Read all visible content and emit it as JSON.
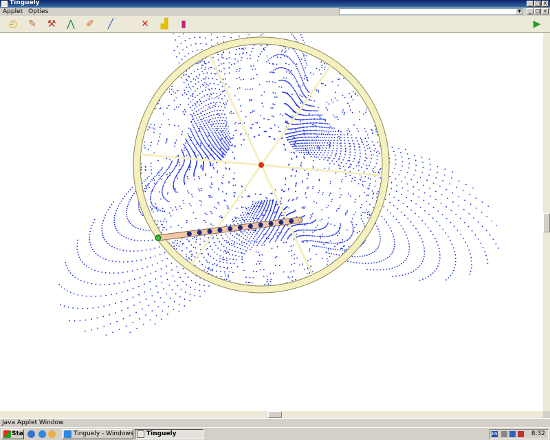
{
  "window": {
    "title": "Tinguely",
    "controls": [
      "_",
      "□",
      "X"
    ]
  },
  "menubar": {
    "items": [
      "Applet",
      "Opties"
    ],
    "combo_value": ""
  },
  "toolbar": {
    "tools": [
      {
        "name": "clock-icon",
        "glyph": "◴",
        "color": "#c8a000"
      },
      {
        "name": "eraser-icon",
        "glyph": "✎",
        "color": "#b07040"
      },
      {
        "name": "hammer-icon",
        "glyph": "⚒",
        "color": "#c03020"
      },
      {
        "name": "compass-icon",
        "glyph": "⋀",
        "color": "#208040"
      },
      {
        "name": "bandage-icon",
        "glyph": "✐",
        "color": "#e06020"
      },
      {
        "name": "pen-icon",
        "glyph": "╱",
        "color": "#2060c0"
      },
      {
        "name": "clear-icon",
        "glyph": "✕",
        "color": "#e02020"
      },
      {
        "name": "chart-icon",
        "glyph": "▟",
        "color": "#e0c000"
      },
      {
        "name": "palette-icon",
        "glyph": "▮",
        "color": "#c02080"
      },
      {
        "name": "play-icon",
        "glyph": "▶",
        "color": "#20a020"
      }
    ]
  },
  "colors": {
    "drawing": "#1a2ee6",
    "wheel_rim": "#f5f0c0",
    "wheel_edge": "#8a8450",
    "hub": "#e03010",
    "arm": "#f0c8a8",
    "pen_tip": "#30c030",
    "dots": "#202880"
  },
  "status": {
    "text": "Java Applet Window"
  },
  "taskbar": {
    "start_label": "Start",
    "tasks": [
      {
        "label": "Tinguely - Windows Inter...",
        "active": false
      },
      {
        "label": "Tinguely",
        "active": true
      }
    ],
    "tray": {
      "language": "EN",
      "clock": "8:32"
    }
  }
}
